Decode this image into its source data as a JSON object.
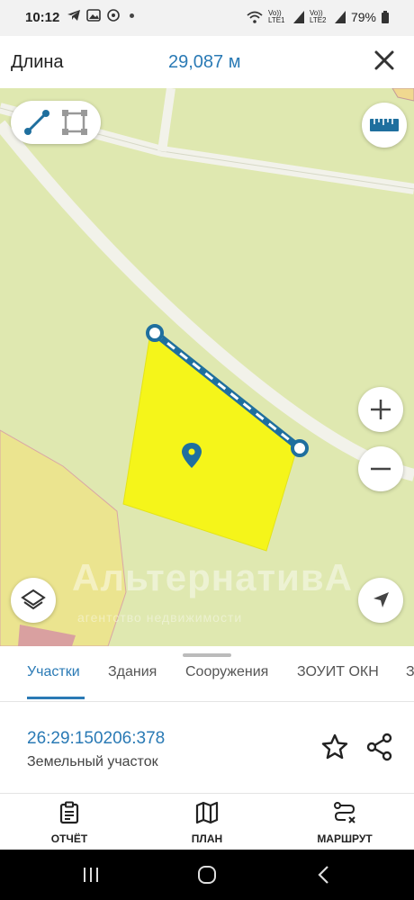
{
  "status_bar": {
    "time": "10:12",
    "battery": "79%",
    "sim1": "Vo)) LTE1",
    "sim2": "Vo)) LTE2"
  },
  "header": {
    "title": "Длина",
    "measurement": "29,087 м",
    "close_icon": "close-icon"
  },
  "map": {
    "watermark": "АльтернативА",
    "watermark_sub": "агентство недвижимости",
    "tools": [
      "line-measure-icon",
      "area-measure-icon"
    ],
    "colors": {
      "map_bg": "#dfe8b0",
      "parcel": "#f5f51a",
      "line": "#1f6f9e",
      "accent": "#2a7ab5"
    }
  },
  "tabs": [
    {
      "label": "Участки",
      "active": true
    },
    {
      "label": "Здания",
      "active": false
    },
    {
      "label": "Сооружения",
      "active": false
    },
    {
      "label": "ЗОУИТ ОКН",
      "active": false
    },
    {
      "label": "З",
      "active": false
    }
  ],
  "parcel": {
    "cadastral_number": "26:29:150206:378",
    "type": "Земельный участок"
  },
  "bottom_nav": [
    {
      "label": "ОТЧЁТ",
      "icon": "report-clipboard-icon"
    },
    {
      "label": "ПЛАН",
      "icon": "map-plan-icon"
    },
    {
      "label": "МАРШРУТ",
      "icon": "route-icon"
    }
  ]
}
